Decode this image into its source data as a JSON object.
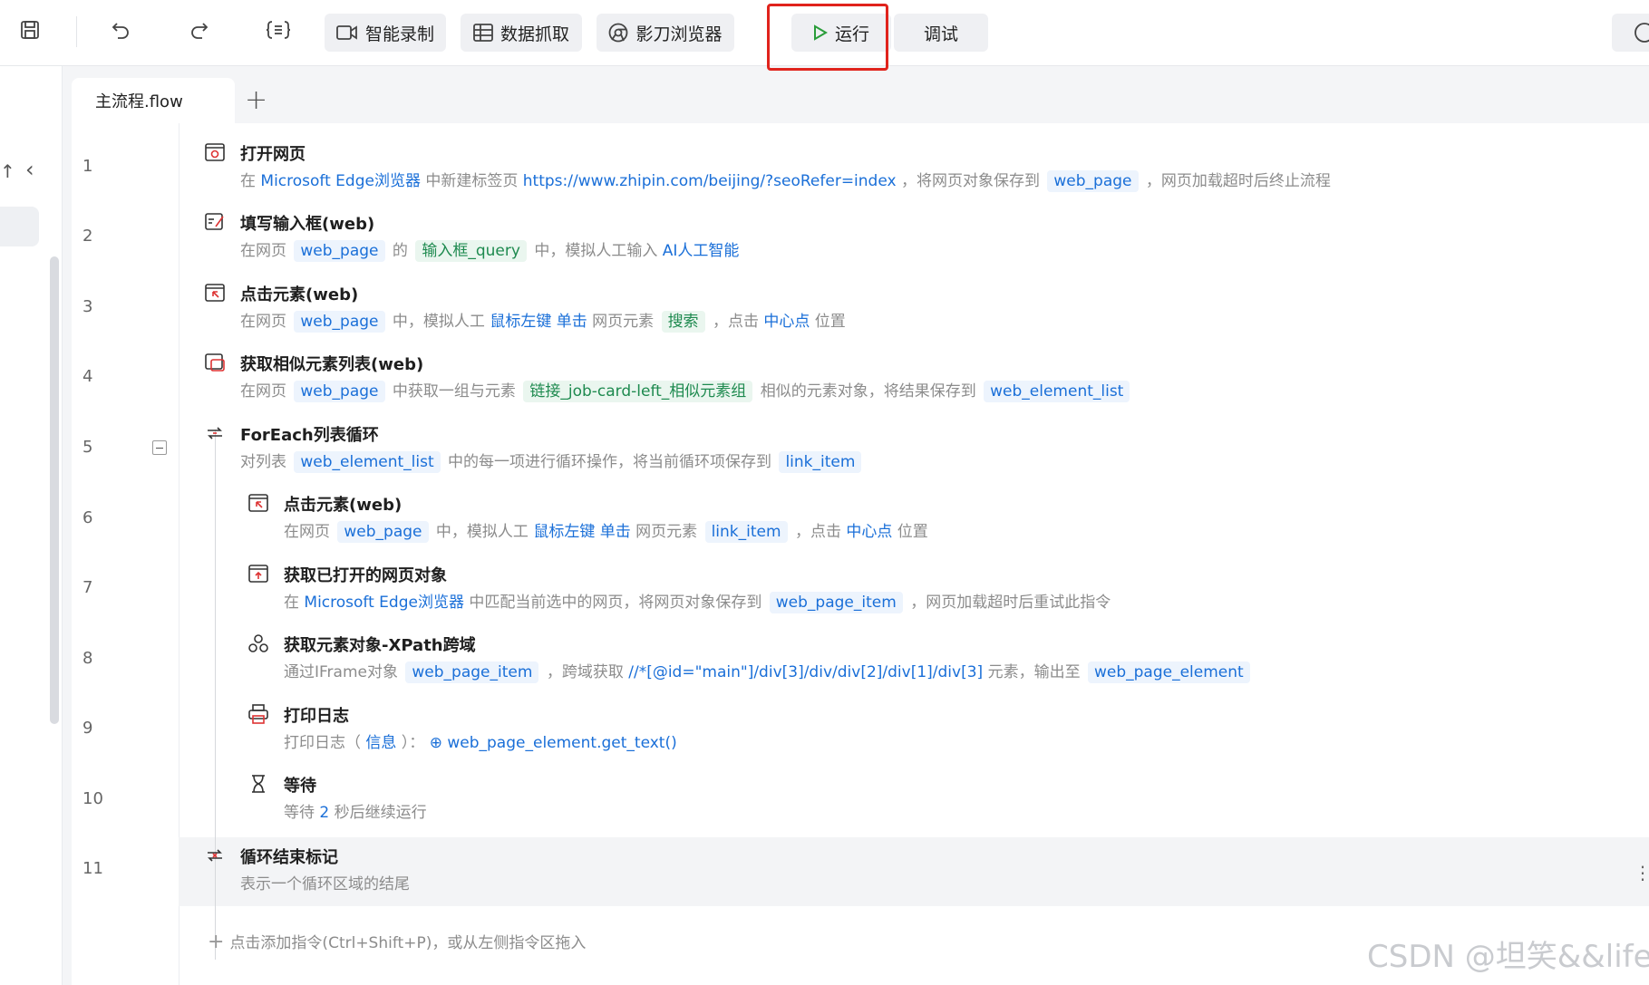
{
  "toolbar": {
    "icons": [
      "save-icon",
      "undo-icon",
      "redo-icon",
      "variable-braces-icon"
    ],
    "smart_record": "智能录制",
    "data_capture": "数据抓取",
    "browser": "影刀浏览器",
    "run": "运行",
    "debug": "调试",
    "run_highlight_color": "#e0231c"
  },
  "tabs": {
    "active": "主流程.flow",
    "add_icon": "plus-icon"
  },
  "steps": [
    {
      "no": "1",
      "title": "打开网页",
      "icon": "open-web-icon",
      "d": [
        "在 ",
        "Microsoft Edge浏览器",
        " 中新建标签页 ",
        "https://www.zhipin.com/beijing/?seoRefer=index",
        " ，将网页对象保存到 ",
        "web_page",
        " ，网页加载超时后终止流程"
      ]
    },
    {
      "no": "2",
      "title": "填写输入框(web)",
      "icon": "fill-input-icon",
      "d": [
        "在网页 ",
        "web_page",
        " 的 ",
        "输入框_query",
        " 中，模拟人工输入 ",
        "AI人工智能"
      ]
    },
    {
      "no": "3",
      "title": "点击元素(web)",
      "icon": "click-element-icon",
      "d": [
        "在网页 ",
        "web_page",
        " 中，模拟人工 ",
        "鼠标左键 单击",
        " 网页元素 ",
        "搜索",
        " ，点击 ",
        "中心点",
        " 位置"
      ]
    },
    {
      "no": "4",
      "title": "获取相似元素列表(web)",
      "icon": "similar-elements-icon",
      "d": [
        "在网页 ",
        "web_page",
        " 中获取一组与元素 ",
        "链接_job-card-left_相似元素组",
        " 相似的元素对象，将结果保存到 ",
        "web_element_list"
      ]
    },
    {
      "no": "5",
      "title": "ForEach列表循环",
      "icon": "foreach-loop-icon",
      "d": [
        "对列表 ",
        "web_element_list",
        " 中的每一项进行循环操作，将当前循环项保存到 ",
        "link_item"
      ]
    },
    {
      "no": "6",
      "title": "点击元素(web)",
      "icon": "click-element-icon",
      "d": [
        "在网页 ",
        "web_page",
        " 中，模拟人工 ",
        "鼠标左键 单击",
        " 网页元素 ",
        "link_item",
        " ，点击 ",
        "中心点",
        " 位置"
      ]
    },
    {
      "no": "7",
      "title": "获取已打开的网页对象",
      "icon": "get-opened-page-icon",
      "d": [
        "在 ",
        "Microsoft Edge浏览器",
        " 中匹配当前选中的网页，将网页对象保存到 ",
        "web_page_item",
        " ，网页加载超时后重试此指令"
      ]
    },
    {
      "no": "8",
      "title": "获取元素对象-XPath跨域",
      "icon": "xpath-cross-domain-icon",
      "d": [
        "通过IFrame对象 ",
        "web_page_item",
        " ，跨域获取 ",
        "//*[@id=\"main\"]/div[3]/div/div[2]/div[1]/div[3]",
        " 元素，输出至 ",
        "web_page_element"
      ]
    },
    {
      "no": "9",
      "title": "打印日志",
      "icon": "print-log-icon",
      "d": [
        "打印日志（ ",
        "信息",
        " ）： ",
        "⊕ web_page_element.get_text()"
      ]
    },
    {
      "no": "10",
      "title": "等待",
      "icon": "hourglass-icon",
      "d": [
        "等待 ",
        "2",
        " 秒后继续运行"
      ]
    },
    {
      "no": "11",
      "title": "循环结束标记",
      "icon": "loop-end-icon",
      "d": [
        "表示一个循环区域的结尾"
      ]
    }
  ],
  "add_hint": "点击添加指令(Ctrl+Shift+P)，或从左侧指令区拖入",
  "watermark": "CSDN @坦笑&&life",
  "colors": {
    "keyword": "#1a6fd8",
    "element": "#1e8a4f",
    "desc": "#8c8c8c"
  }
}
